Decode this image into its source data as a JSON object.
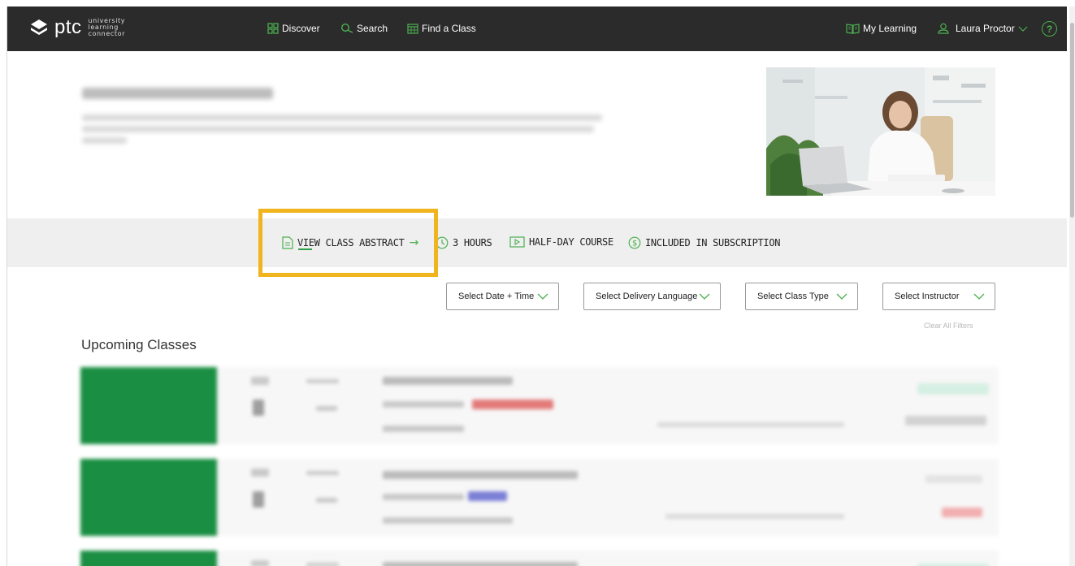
{
  "nav": {
    "logo_text": "ptc",
    "logo_sub": [
      "university",
      "learning",
      "connector"
    ],
    "discover": "Discover",
    "search": "Search",
    "find_class": "Find a Class",
    "my_learning": "My Learning",
    "user_name": "Laura Proctor",
    "help": "?"
  },
  "meta": {
    "view_abstract": "VIEW CLASS ABSTRACT",
    "arrow": "→",
    "hours": "3 HOURS",
    "course_type": "HALF-DAY COURSE",
    "subscription": "INCLUDED IN SUBSCRIPTION"
  },
  "filters": {
    "date_time": "Select Date + Time",
    "language": "Select Delivery Language",
    "class_type": "Select Class Type",
    "instructor": "Select Instructor",
    "clear_all": "Clear All Filters"
  },
  "upcoming": {
    "title": "Upcoming Classes"
  },
  "colors": {
    "accent_green": "#4caf50",
    "highlight": "#f0b41e",
    "nav_bg": "#2b2b2b",
    "badge_green": "#1a8f43"
  }
}
